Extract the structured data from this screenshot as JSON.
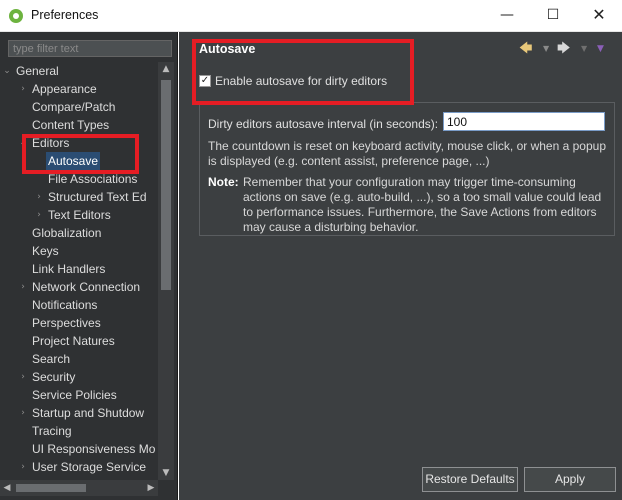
{
  "window": {
    "title": "Preferences",
    "minimize_glyph": "—",
    "maximize_glyph": "☐",
    "close_glyph": "✕"
  },
  "filter": {
    "placeholder": "type filter text"
  },
  "tree": {
    "items": [
      {
        "label": "General",
        "depth": 0,
        "expanded": true,
        "has_children": true
      },
      {
        "label": "Appearance",
        "depth": 1,
        "expanded": false,
        "has_children": true
      },
      {
        "label": "Compare/Patch",
        "depth": 1,
        "has_children": false
      },
      {
        "label": "Content Types",
        "depth": 1,
        "has_children": false
      },
      {
        "label": "Editors",
        "depth": 1,
        "expanded": true,
        "has_children": true
      },
      {
        "label": "Autosave",
        "depth": 2,
        "has_children": false,
        "selected": true
      },
      {
        "label": "File Associations",
        "depth": 2,
        "has_children": false
      },
      {
        "label": "Structured Text Ed",
        "depth": 2,
        "expanded": false,
        "has_children": true
      },
      {
        "label": "Text Editors",
        "depth": 2,
        "expanded": false,
        "has_children": true
      },
      {
        "label": "Globalization",
        "depth": 1,
        "has_children": false
      },
      {
        "label": "Keys",
        "depth": 1,
        "has_children": false
      },
      {
        "label": "Link Handlers",
        "depth": 1,
        "has_children": false
      },
      {
        "label": "Network Connection",
        "depth": 1,
        "expanded": false,
        "has_children": true
      },
      {
        "label": "Notifications",
        "depth": 1,
        "has_children": false
      },
      {
        "label": "Perspectives",
        "depth": 1,
        "has_children": false
      },
      {
        "label": "Project Natures",
        "depth": 1,
        "has_children": false
      },
      {
        "label": "Search",
        "depth": 1,
        "has_children": false
      },
      {
        "label": "Security",
        "depth": 1,
        "expanded": false,
        "has_children": true
      },
      {
        "label": "Service Policies",
        "depth": 1,
        "has_children": false
      },
      {
        "label": "Startup and Shutdow",
        "depth": 1,
        "expanded": false,
        "has_children": true
      },
      {
        "label": "Tracing",
        "depth": 1,
        "has_children": false
      },
      {
        "label": "UI Responsiveness Mo",
        "depth": 1,
        "has_children": false
      },
      {
        "label": "User Storage Service",
        "depth": 1,
        "expanded": false,
        "has_children": true
      }
    ]
  },
  "page": {
    "title": "Autosave",
    "enable_checkbox": {
      "label": "Enable autosave for dirty editors",
      "checked": true
    },
    "interval_label": "Dirty editors autosave interval (in seconds):",
    "interval_value": "100",
    "countdown_text": "The countdown is reset on keyboard activity, mouse click, or when a popup is displayed (e.g. content assist, preference page, ...)",
    "note_label": "Note:",
    "note_text": "Remember that your configuration may trigger time-consuming actions on save (e.g. auto-build, ...), so a too small value could lead to performance issues. Furthermore, the Save Actions from editors may cause a disturbing behavior."
  },
  "buttons": {
    "restore_defaults": "Restore Defaults",
    "apply": "Apply"
  },
  "colors": {
    "panel_bg": "#3c3f41",
    "tree_bg": "#2f3133",
    "selection": "#2b4d73",
    "highlight": "#e51d24"
  }
}
